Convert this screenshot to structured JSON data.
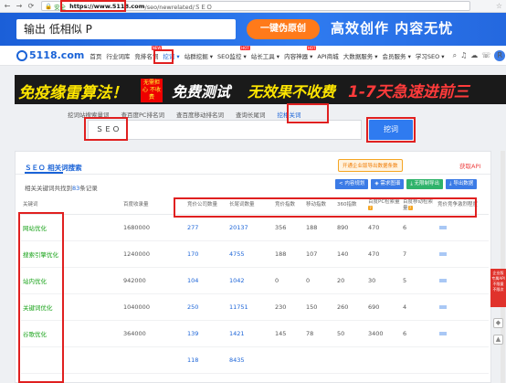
{
  "browser": {
    "back": "←",
    "forward": "→",
    "reload": "⟳",
    "secure_label": "安全",
    "url_host": "https://www.5118.com",
    "url_path": "/seo/newrelated/ＳＥＯ",
    "star": "☆"
  },
  "banner": {
    "input_text": "输出 低相似 P",
    "button_label": "一键伪原创",
    "slogan": "高效创作  内容无忧"
  },
  "site_nav": {
    "logo": "5118.com",
    "items": [
      {
        "label": "首页",
        "active": false,
        "hot": ""
      },
      {
        "label": "行业词库",
        "active": false,
        "hot": ""
      },
      {
        "label": "竞排名词",
        "active": false,
        "hot": "NEW"
      },
      {
        "label": "挖词 ▾",
        "active": true,
        "hot": ""
      },
      {
        "label": "站群挖掘 ▾",
        "active": false,
        "hot": ""
      },
      {
        "label": "SEO监控 ▾",
        "active": false,
        "hot": "HOT"
      },
      {
        "label": "站长工具 ▾",
        "active": false,
        "hot": ""
      },
      {
        "label": "内容神器 ▾",
        "active": false,
        "hot": "HOT"
      },
      {
        "label": "API商城",
        "active": false,
        "hot": ""
      },
      {
        "label": "大数据服务 ▾",
        "active": false,
        "hot": ""
      },
      {
        "label": "会员服务 ▾",
        "active": false,
        "hot": ""
      },
      {
        "label": "学习SEO ▾",
        "active": false,
        "hot": ""
      }
    ],
    "right_icons": [
      "search-icon",
      "bell-icon",
      "cloud-icon",
      "phone-icon"
    ],
    "avatar_letter": "R"
  },
  "promo": {
    "p1": "免疫缘雷算法！",
    "p2": "无需担心 不收费",
    "p3": "免费测试",
    "p4": "无效果不收费",
    "p5": "1-7天急速进前三"
  },
  "search": {
    "tabs": [
      {
        "label": "挖词站搜索量词",
        "active": false
      },
      {
        "label": "查百度PC排名词",
        "active": false
      },
      {
        "label": "查百度移动排名词",
        "active": false
      },
      {
        "label": "查询长尾词",
        "active": false
      },
      {
        "label": "挖相关词",
        "active": true
      }
    ],
    "input_value": "ＳＥＯ",
    "button_label": "挖词"
  },
  "card": {
    "title": "ＳＥＯ 相关词搜索",
    "vip_tag": "开通企业版导出数据条数",
    "api_link": "获取API",
    "summary_prefix": "相关关键词共找到",
    "summary_count": "83",
    "summary_suffix": "条记录",
    "tools": [
      {
        "label": "< 内容规划",
        "color": "#3b7be6"
      },
      {
        "label": "◈ 需求图谱",
        "color": "#3b7be6"
      },
      {
        "label": "⤓ 无限制导出",
        "color": "#2fb36b"
      },
      {
        "label": "⤓ 导出数据",
        "color": "#3b7be6"
      }
    ]
  },
  "table": {
    "headers": [
      "关键词",
      "百度收录量",
      "竞价公司数量",
      "长尾词数量",
      "竞价指数",
      "移动指数",
      "360指数",
      "百度PC检索量",
      "百度移动检索量",
      "竞价竞争激烈程度"
    ],
    "rows": [
      {
        "kw": "网站优化",
        "index": "1680000",
        "comp": "277",
        "long": "20137",
        "bid": "356",
        "mob": "188",
        "s360": "890",
        "pc": "470",
        "mobq": "6"
      },
      {
        "kw": "搜索引擎优化",
        "index": "1240000",
        "comp": "170",
        "long": "4755",
        "bid": "188",
        "mob": "107",
        "s360": "140",
        "pc": "470",
        "mobq": "7"
      },
      {
        "kw": "站内优化",
        "index": "942000",
        "comp": "104",
        "long": "1042",
        "bid": "0",
        "mob": "0",
        "s360": "20",
        "pc": "30",
        "mobq": "5"
      },
      {
        "kw": "关键词优化",
        "index": "1040000",
        "comp": "250",
        "long": "11751",
        "bid": "230",
        "mob": "150",
        "s360": "260",
        "pc": "690",
        "mobq": "4"
      },
      {
        "kw": "谷歌优化",
        "index": "364000",
        "comp": "139",
        "long": "1421",
        "bid": "145",
        "mob": "78",
        "s360": "50",
        "pc": "3400",
        "mobq": "6"
      },
      {
        "kw": "",
        "index": "",
        "comp": "118",
        "long": "8435",
        "bid": "",
        "mob": "",
        "s360": "",
        "pc": "",
        "mobq": ""
      }
    ]
  },
  "side": {
    "float_text": "企业版 专属API 不限量 不限次",
    "up_icon": "▲",
    "down_icon": "◆"
  }
}
